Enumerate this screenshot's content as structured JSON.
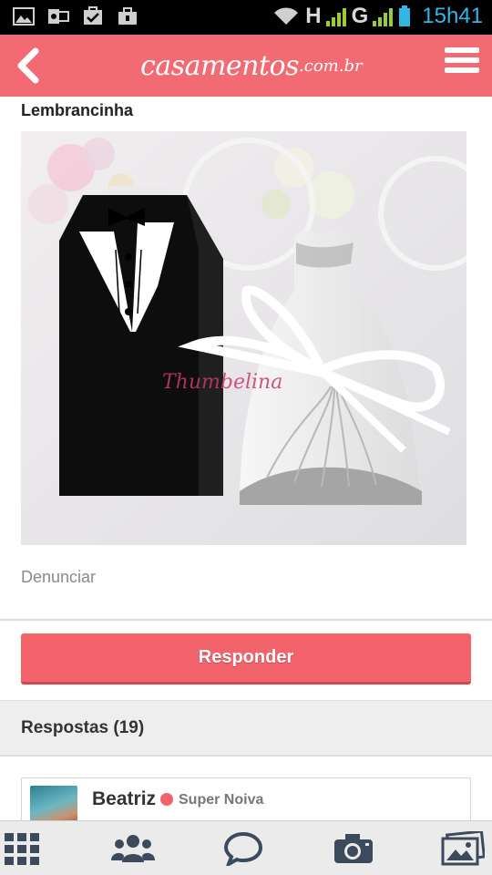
{
  "status_bar": {
    "network_1": "H",
    "network_2": "G",
    "time": "15h41"
  },
  "header": {
    "logo_text": "casamentos",
    "logo_domain": ".com.br",
    "back_icon": "chevron-left-icon",
    "menu_icon": "hamburger-menu-icon",
    "color": "#f36b72"
  },
  "post": {
    "title": "Lembrancinha",
    "image_caption_watermark": "Thumbelina",
    "report_label": "Denunciar"
  },
  "reply_button": {
    "label": "Responder",
    "color": "#f3636c"
  },
  "answers": {
    "title": "Respostas (19)",
    "items": [
      {
        "name": "Beatriz",
        "rank": "Super Noiva"
      }
    ]
  },
  "bottom_nav": {
    "items": [
      {
        "icon": "grid-icon"
      },
      {
        "icon": "community-icon"
      },
      {
        "icon": "chat-bubble-icon"
      },
      {
        "icon": "camera-icon"
      },
      {
        "icon": "gallery-icon"
      }
    ]
  }
}
